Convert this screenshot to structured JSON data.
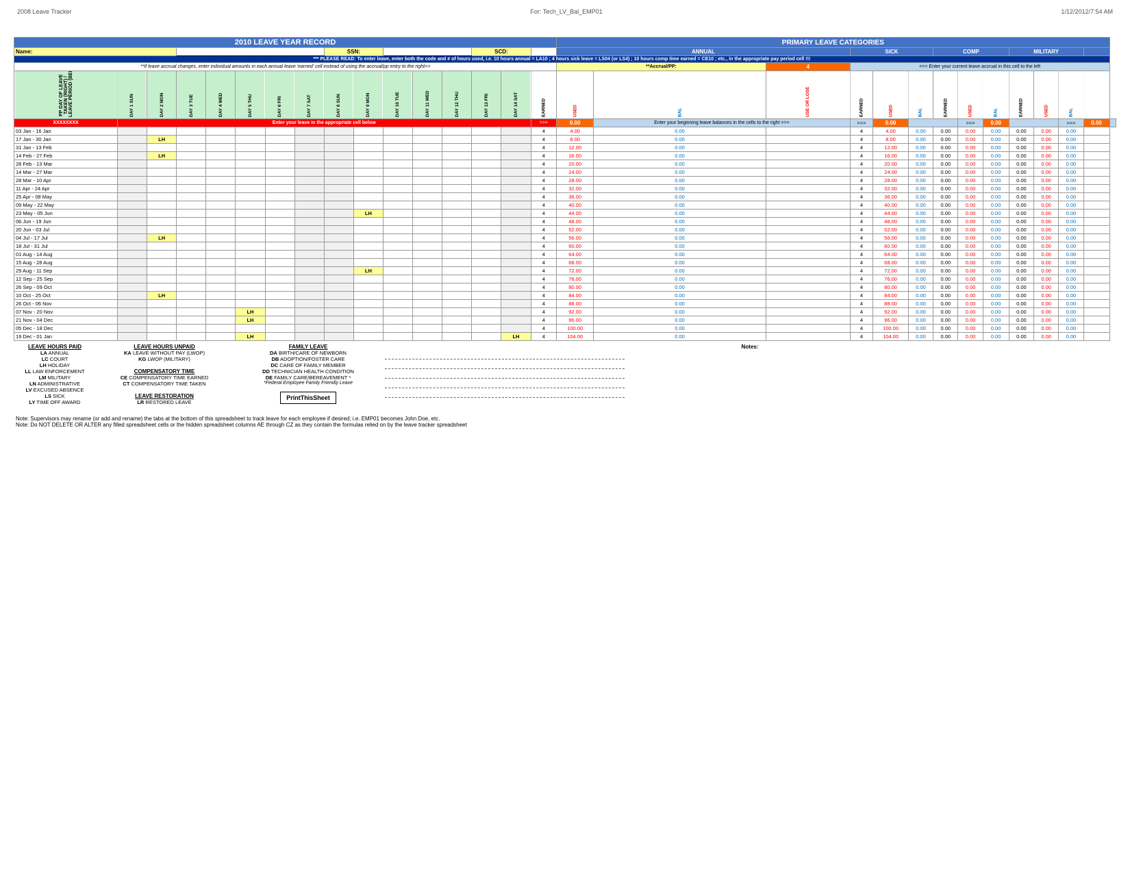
{
  "app": {
    "title": "2008 Leave Tracker",
    "for_label": "For: Tech_LV_Bal_EMP01",
    "date": "1/12/2012/7:54 AM"
  },
  "spreadsheet_title": "2010 LEAVE YEAR RECORD",
  "primary_categories_title": "PRIMARY LEAVE CATEGORIES",
  "name_label": "Name:",
  "ssn_label": "SSN:",
  "scd_label": "SCD:",
  "annual_label": "ANNUAL",
  "sick_label": "SICK",
  "comp_label": "COMP",
  "military_label": "MILITARY",
  "warning_text": "*** PLEASE READ: To enter leave, enter both the code and # of hours used, i.e. 10 hours annual = LA10 ; 4 hours sick leave = LS04 (or LS4) ; 10 hours comp time earned = CE10 ; etc., in the appropriate pay period cell !!!",
  "accrual_text": "**If leave accrual changes, enter individual amounts in each annual leave 'earned' cell instead of using the accrual/pp entry to the right>>",
  "accrual_pp_label": "**Accrual/PP:",
  "accrual_value": "4",
  "enter_left_text": "Enter your leave in the appropriate cell below",
  "enter_right_text": "Enter your beginning leave balances in the cells to the right >>>",
  "day_headers": [
    "DAY 1 SUN",
    "DAY 2 MON",
    "DAY 3 TUE",
    "DAY 4 WED",
    "DAY 5 THU",
    "DAY 6 FRI",
    "DAY 7 SAT",
    "DAY 8 SUN",
    "DAY 9 MON",
    "DAY 10 TUE",
    "DAY 11 WED",
    "DAY 12 THU",
    "DAY 13 FRI",
    "DAY 14 SAT"
  ],
  "right_headers": [
    "EARNED",
    "USED",
    "BAL",
    "USE OR LOSE",
    "EARNED",
    "USED",
    "BAL",
    "EARNED",
    "USED",
    "BAL",
    "EARNED",
    "USED",
    "BAL"
  ],
  "pp_day_label": "PP DAY OF LEAVE\nTAKEN (RIGHT) / LEAVE\nPERIOD (BELOW)",
  "rows": [
    {
      "date": "03 Jan - 16 Jan",
      "days": [
        "",
        "",
        "",
        "",
        "",
        "",
        "",
        "",
        "",
        "",
        "",
        "",
        "",
        ""
      ],
      "earned": "4",
      "used": "4.00",
      "bal": "0.00",
      "lose": "",
      "s_earned": "4",
      "s_used": "4.00",
      "s_bal": "0.00",
      "c_earned": "0.00",
      "c_used": "0.00",
      "c_bal": "0.00",
      "m_earned": "0.00",
      "m_used": "0.00",
      "m_bal": "0.00"
    },
    {
      "date": "17 Jan - 30 Jan",
      "days": [
        "",
        "LH",
        "",
        "",
        "",
        "",
        "",
        "",
        "",
        "",
        "",
        "",
        "",
        ""
      ],
      "earned": "4",
      "used": "8.00",
      "bal": "0.00",
      "lose": "",
      "s_earned": "4",
      "s_used": "8.00",
      "s_bal": "0.00",
      "c_earned": "0.00",
      "c_used": "0.00",
      "c_bal": "0.00",
      "m_earned": "0.00",
      "m_used": "0.00",
      "m_bal": "0.00"
    },
    {
      "date": "31 Jan - 13 Feb",
      "days": [
        "",
        "",
        "",
        "",
        "",
        "",
        "",
        "",
        "",
        "",
        "",
        "",
        "",
        ""
      ],
      "earned": "4",
      "used": "12.00",
      "bal": "0.00",
      "lose": "",
      "s_earned": "4",
      "s_used": "12.00",
      "s_bal": "0.00",
      "c_earned": "0.00",
      "c_used": "0.00",
      "c_bal": "0.00",
      "m_earned": "0.00",
      "m_used": "0.00",
      "m_bal": "0.00"
    },
    {
      "date": "14 Feb - 27 Feb",
      "days": [
        "",
        "LH",
        "",
        "",
        "",
        "",
        "",
        "",
        "",
        "",
        "",
        "",
        "",
        ""
      ],
      "earned": "4",
      "used": "16.00",
      "bal": "0.00",
      "lose": "",
      "s_earned": "4",
      "s_used": "16.00",
      "s_bal": "0.00",
      "c_earned": "0.00",
      "c_used": "0.00",
      "c_bal": "0.00",
      "m_earned": "0.00",
      "m_used": "0.00",
      "m_bal": "0.00"
    },
    {
      "date": "28 Feb - 13 Mar",
      "days": [
        "",
        "",
        "",
        "",
        "",
        "",
        "",
        "",
        "",
        "",
        "",
        "",
        "",
        ""
      ],
      "earned": "4",
      "used": "20.00",
      "bal": "0.00",
      "lose": "",
      "s_earned": "4",
      "s_used": "20.00",
      "s_bal": "0.00",
      "c_earned": "0.00",
      "c_used": "0.00",
      "c_bal": "0.00",
      "m_earned": "0.00",
      "m_used": "0.00",
      "m_bal": "0.00"
    },
    {
      "date": "14 Mar - 27 Mar",
      "days": [
        "",
        "",
        "",
        "",
        "",
        "",
        "",
        "",
        "",
        "",
        "",
        "",
        "",
        ""
      ],
      "earned": "4",
      "used": "24.00",
      "bal": "0.00",
      "lose": "",
      "s_earned": "4",
      "s_used": "24.00",
      "s_bal": "0.00",
      "c_earned": "0.00",
      "c_used": "0.00",
      "c_bal": "0.00",
      "m_earned": "0.00",
      "m_used": "0.00",
      "m_bal": "0.00"
    },
    {
      "date": "28 Mar - 10 Apr",
      "days": [
        "",
        "",
        "",
        "",
        "",
        "",
        "",
        "",
        "",
        "",
        "",
        "",
        "",
        ""
      ],
      "earned": "4",
      "used": "28.00",
      "bal": "0.00",
      "lose": "",
      "s_earned": "4",
      "s_used": "28.00",
      "s_bal": "0.00",
      "c_earned": "0.00",
      "c_used": "0.00",
      "c_bal": "0.00",
      "m_earned": "0.00",
      "m_used": "0.00",
      "m_bal": "0.00"
    },
    {
      "date": "11 Apr - 24 Apr",
      "days": [
        "",
        "",
        "",
        "",
        "",
        "",
        "",
        "",
        "",
        "",
        "",
        "",
        "",
        ""
      ],
      "earned": "4",
      "used": "32.00",
      "bal": "0.00",
      "lose": "",
      "s_earned": "4",
      "s_used": "32.00",
      "s_bal": "0.00",
      "c_earned": "0.00",
      "c_used": "0.00",
      "c_bal": "0.00",
      "m_earned": "0.00",
      "m_used": "0.00",
      "m_bal": "0.00"
    },
    {
      "date": "25 Apr - 08 May",
      "days": [
        "",
        "",
        "",
        "",
        "",
        "",
        "",
        "",
        "",
        "",
        "",
        "",
        "",
        ""
      ],
      "earned": "4",
      "used": "36.00",
      "bal": "0.00",
      "lose": "",
      "s_earned": "4",
      "s_used": "36.00",
      "s_bal": "0.00",
      "c_earned": "0.00",
      "c_used": "0.00",
      "c_bal": "0.00",
      "m_earned": "0.00",
      "m_used": "0.00",
      "m_bal": "0.00"
    },
    {
      "date": "09 May - 22 May",
      "days": [
        "",
        "",
        "",
        "",
        "",
        "",
        "",
        "",
        "",
        "",
        "",
        "",
        "",
        ""
      ],
      "earned": "4",
      "used": "40.00",
      "bal": "0.00",
      "lose": "",
      "s_earned": "4",
      "s_used": "40.00",
      "s_bal": "0.00",
      "c_earned": "0.00",
      "c_used": "0.00",
      "c_bal": "0.00",
      "m_earned": "0.00",
      "m_used": "0.00",
      "m_bal": "0.00"
    },
    {
      "date": "23 May - 05 Jun",
      "days": [
        "",
        "",
        "",
        "",
        "",
        "",
        "",
        "",
        "LH",
        "",
        "",
        "",
        "",
        ""
      ],
      "earned": "4",
      "used": "44.00",
      "bal": "0.00",
      "lose": "",
      "s_earned": "4",
      "s_used": "44.00",
      "s_bal": "0.00",
      "c_earned": "0.00",
      "c_used": "0.00",
      "c_bal": "0.00",
      "m_earned": "0.00",
      "m_used": "0.00",
      "m_bal": "0.00"
    },
    {
      "date": "06 Jun - 19 Jun",
      "days": [
        "",
        "",
        "",
        "",
        "",
        "",
        "",
        "",
        "",
        "",
        "",
        "",
        "",
        ""
      ],
      "earned": "4",
      "used": "48.00",
      "bal": "0.00",
      "lose": "",
      "s_earned": "4",
      "s_used": "48.00",
      "s_bal": "0.00",
      "c_earned": "0.00",
      "c_used": "0.00",
      "c_bal": "0.00",
      "m_earned": "0.00",
      "m_used": "0.00",
      "m_bal": "0.00"
    },
    {
      "date": "20 Jun - 03 Jul",
      "days": [
        "",
        "",
        "",
        "",
        "",
        "",
        "",
        "",
        "",
        "",
        "",
        "",
        "",
        ""
      ],
      "earned": "4",
      "used": "52.00",
      "bal": "0.00",
      "lose": "",
      "s_earned": "4",
      "s_used": "52.00",
      "s_bal": "0.00",
      "c_earned": "0.00",
      "c_used": "0.00",
      "c_bal": "0.00",
      "m_earned": "0.00",
      "m_used": "0.00",
      "m_bal": "0.00"
    },
    {
      "date": "04 Jul - 17 Jul",
      "days": [
        "",
        "LH",
        "",
        "",
        "",
        "",
        "",
        "",
        "",
        "",
        "",
        "",
        "",
        ""
      ],
      "earned": "4",
      "used": "56.00",
      "bal": "0.00",
      "lose": "",
      "s_earned": "4",
      "s_used": "56.00",
      "s_bal": "0.00",
      "c_earned": "0.00",
      "c_used": "0.00",
      "c_bal": "0.00",
      "m_earned": "0.00",
      "m_used": "0.00",
      "m_bal": "0.00"
    },
    {
      "date": "18 Jul - 31 Jul",
      "days": [
        "",
        "",
        "",
        "",
        "",
        "",
        "",
        "",
        "",
        "",
        "",
        "",
        "",
        ""
      ],
      "earned": "4",
      "used": "60.00",
      "bal": "0.00",
      "lose": "",
      "s_earned": "4",
      "s_used": "60.00",
      "s_bal": "0.00",
      "c_earned": "0.00",
      "c_used": "0.00",
      "c_bal": "0.00",
      "m_earned": "0.00",
      "m_used": "0.00",
      "m_bal": "0.00"
    },
    {
      "date": "01 Aug - 14 Aug",
      "days": [
        "",
        "",
        "",
        "",
        "",
        "",
        "",
        "",
        "",
        "",
        "",
        "",
        "",
        ""
      ],
      "earned": "4",
      "used": "64.00",
      "bal": "0.00",
      "lose": "",
      "s_earned": "4",
      "s_used": "64.00",
      "s_bal": "0.00",
      "c_earned": "0.00",
      "c_used": "0.00",
      "c_bal": "0.00",
      "m_earned": "0.00",
      "m_used": "0.00",
      "m_bal": "0.00"
    },
    {
      "date": "15 Aug - 28 Aug",
      "days": [
        "",
        "",
        "",
        "",
        "",
        "",
        "",
        "",
        "",
        "",
        "",
        "",
        "",
        ""
      ],
      "earned": "4",
      "used": "68.00",
      "bal": "0.00",
      "lose": "",
      "s_earned": "4",
      "s_used": "68.00",
      "s_bal": "0.00",
      "c_earned": "0.00",
      "c_used": "0.00",
      "c_bal": "0.00",
      "m_earned": "0.00",
      "m_used": "0.00",
      "m_bal": "0.00"
    },
    {
      "date": "29 Aug - 11 Sep",
      "days": [
        "",
        "",
        "",
        "",
        "",
        "",
        "",
        "",
        "LH",
        "",
        "",
        "",
        "",
        ""
      ],
      "earned": "4",
      "used": "72.00",
      "bal": "0.00",
      "lose": "",
      "s_earned": "4",
      "s_used": "72.00",
      "s_bal": "0.00",
      "c_earned": "0.00",
      "c_used": "0.00",
      "c_bal": "0.00",
      "m_earned": "0.00",
      "m_used": "0.00",
      "m_bal": "0.00"
    },
    {
      "date": "12 Sep - 25 Sep",
      "days": [
        "",
        "",
        "",
        "",
        "",
        "",
        "",
        "",
        "",
        "",
        "",
        "",
        "",
        ""
      ],
      "earned": "4",
      "used": "76.00",
      "bal": "0.00",
      "lose": "",
      "s_earned": "4",
      "s_used": "76.00",
      "s_bal": "0.00",
      "c_earned": "0.00",
      "c_used": "0.00",
      "c_bal": "0.00",
      "m_earned": "0.00",
      "m_used": "0.00",
      "m_bal": "0.00"
    },
    {
      "date": "26 Sep - 09 Oct",
      "days": [
        "",
        "",
        "",
        "",
        "",
        "",
        "",
        "",
        "",
        "",
        "",
        "",
        "",
        ""
      ],
      "earned": "4",
      "used": "80.00",
      "bal": "0.00",
      "lose": "",
      "s_earned": "4",
      "s_used": "80.00",
      "s_bal": "0.00",
      "c_earned": "0.00",
      "c_used": "0.00",
      "c_bal": "0.00",
      "m_earned": "0.00",
      "m_used": "0.00",
      "m_bal": "0.00"
    },
    {
      "date": "10 Oct - 25 Oct",
      "days": [
        "",
        "LH",
        "",
        "",
        "",
        "",
        "",
        "",
        "",
        "",
        "",
        "",
        "",
        ""
      ],
      "earned": "4",
      "used": "84.00",
      "bal": "0.00",
      "lose": "",
      "s_earned": "4",
      "s_used": "84.00",
      "s_bal": "0.00",
      "c_earned": "0.00",
      "c_used": "0.00",
      "c_bal": "0.00",
      "m_earned": "0.00",
      "m_used": "0.00",
      "m_bal": "0.00"
    },
    {
      "date": "26 Oct - 06 Nov",
      "days": [
        "",
        "",
        "",
        "",
        "",
        "",
        "",
        "",
        "",
        "",
        "",
        "",
        "",
        ""
      ],
      "earned": "4",
      "used": "88.00",
      "bal": "0.00",
      "lose": "",
      "s_earned": "4",
      "s_used": "88.00",
      "s_bal": "0.00",
      "c_earned": "0.00",
      "c_used": "0.00",
      "c_bal": "0.00",
      "m_earned": "0.00",
      "m_used": "0.00",
      "m_bal": "0.00"
    },
    {
      "date": "07 Nov - 20 Nov",
      "days": [
        "",
        "",
        "",
        "",
        "LH",
        "",
        "",
        "",
        "",
        "",
        "",
        "",
        "",
        ""
      ],
      "earned": "4",
      "used": "92.00",
      "bal": "0.00",
      "lose": "",
      "s_earned": "4",
      "s_used": "92.00",
      "s_bal": "0.00",
      "c_earned": "0.00",
      "c_used": "0.00",
      "c_bal": "0.00",
      "m_earned": "0.00",
      "m_used": "0.00",
      "m_bal": "0.00"
    },
    {
      "date": "21 Nov - 04 Dec",
      "days": [
        "",
        "",
        "",
        "",
        "LH",
        "",
        "",
        "",
        "",
        "",
        "",
        "",
        "",
        ""
      ],
      "earned": "4",
      "used": "96.00",
      "bal": "0.00",
      "lose": "",
      "s_earned": "4",
      "s_used": "96.00",
      "s_bal": "0.00",
      "c_earned": "0.00",
      "c_used": "0.00",
      "c_bal": "0.00",
      "m_earned": "0.00",
      "m_used": "0.00",
      "m_bal": "0.00"
    },
    {
      "date": "05 Dec - 18 Dec",
      "days": [
        "",
        "",
        "",
        "",
        "",
        "",
        "",
        "",
        "",
        "",
        "",
        "",
        "",
        ""
      ],
      "earned": "4",
      "used": "100.00",
      "bal": "0.00",
      "lose": "",
      "s_earned": "4",
      "s_used": "100.00",
      "s_bal": "0.00",
      "c_earned": "0.00",
      "c_used": "0.00",
      "c_bal": "0.00",
      "m_earned": "0.00",
      "m_used": "0.00",
      "m_bal": "0.00"
    },
    {
      "date": "19 Dec - 01 Jan",
      "days": [
        "",
        "",
        "",
        "",
        "LH",
        "",
        "",
        "",
        "",
        "",
        "",
        "",
        "",
        "LH"
      ],
      "earned": "4",
      "used": "104.00",
      "bal": "0.00",
      "lose": "",
      "s_earned": "4",
      "s_used": "104.00",
      "s_bal": "0.00",
      "c_earned": "0.00",
      "c_used": "0.00",
      "c_bal": "0.00",
      "m_earned": "0.00",
      "m_used": "0.00",
      "m_bal": "0.00"
    }
  ],
  "initial_row": {
    "label": "XXXXXXXX",
    "earned_bal": "0.00",
    "s_bal": "0.00",
    "c_bal": "0.00",
    "m_bal": "0.00"
  },
  "legend": {
    "left_title": "LEAVE HOURS PAID",
    "items_paid": [
      {
        "code": "LA",
        "desc": "ANNUAL"
      },
      {
        "code": "LC",
        "desc": "COURT"
      },
      {
        "code": "LH",
        "desc": "HOLIDAY"
      },
      {
        "code": "LL",
        "desc": "LAW ENFORCEMENT"
      },
      {
        "code": "LM",
        "desc": "MILITARY"
      },
      {
        "code": "LN",
        "desc": "ADMINISTRATIVE"
      },
      {
        "code": "LV",
        "desc": "EXCUSED ABSENCE"
      },
      {
        "code": "LS",
        "desc": "SICK"
      },
      {
        "code": "LY",
        "desc": "TIME OFF AWARD"
      }
    ],
    "unpaid_title": "LEAVE HOURS UNPAID",
    "items_unpaid": [
      {
        "code": "KA",
        "desc": "LEAVE WITHOUT PAY (LWOP)"
      },
      {
        "code": "KG",
        "desc": "LWOP (MILITARY)"
      }
    ],
    "comp_title": "COMPENSATORY TIME",
    "items_comp": [
      {
        "code": "CE",
        "desc": "COMPENSATORY TIME EARNED"
      },
      {
        "code": "CT",
        "desc": "COMPENSATORY TIME TAKEN"
      }
    ],
    "restoration_title": "LEAVE RESTORATION",
    "items_restoration": [
      {
        "code": "LR",
        "desc": "RESTORED LEAVE"
      }
    ],
    "family_title": "FAMILY LEAVE",
    "items_family": [
      {
        "code": "DA",
        "desc": "BIRTH/CARE OF NEWBORN"
      },
      {
        "code": "DB",
        "desc": "ADOPTION/FOSTER CARE"
      },
      {
        "code": "DC",
        "desc": "CARE OF FAMILY MEMBER"
      },
      {
        "code": "DD",
        "desc": "TECHNICIAN HEALTH CONDITION"
      },
      {
        "code": "DE",
        "desc": "FAMILY CARE/BEREAVEMENT *"
      }
    ],
    "family_note": "*Federal Employee Family Friendly Leave",
    "print_button": "PrintThisSheet"
  },
  "bottom_notes": [
    "Note:  Supervisors may rename (or add and rename) the tabs at the bottom of this spreadsheet to track leave for each employee if desired; i.e. EMP01 becomes John Doe, etc.",
    "Note:  Do NOT DELETE OR ALTER any filled spreadsheet cells or the hidden spreadsheet columns AE through CZ as they contain the formulas relied on by the leave tracker spreadsheet"
  ]
}
